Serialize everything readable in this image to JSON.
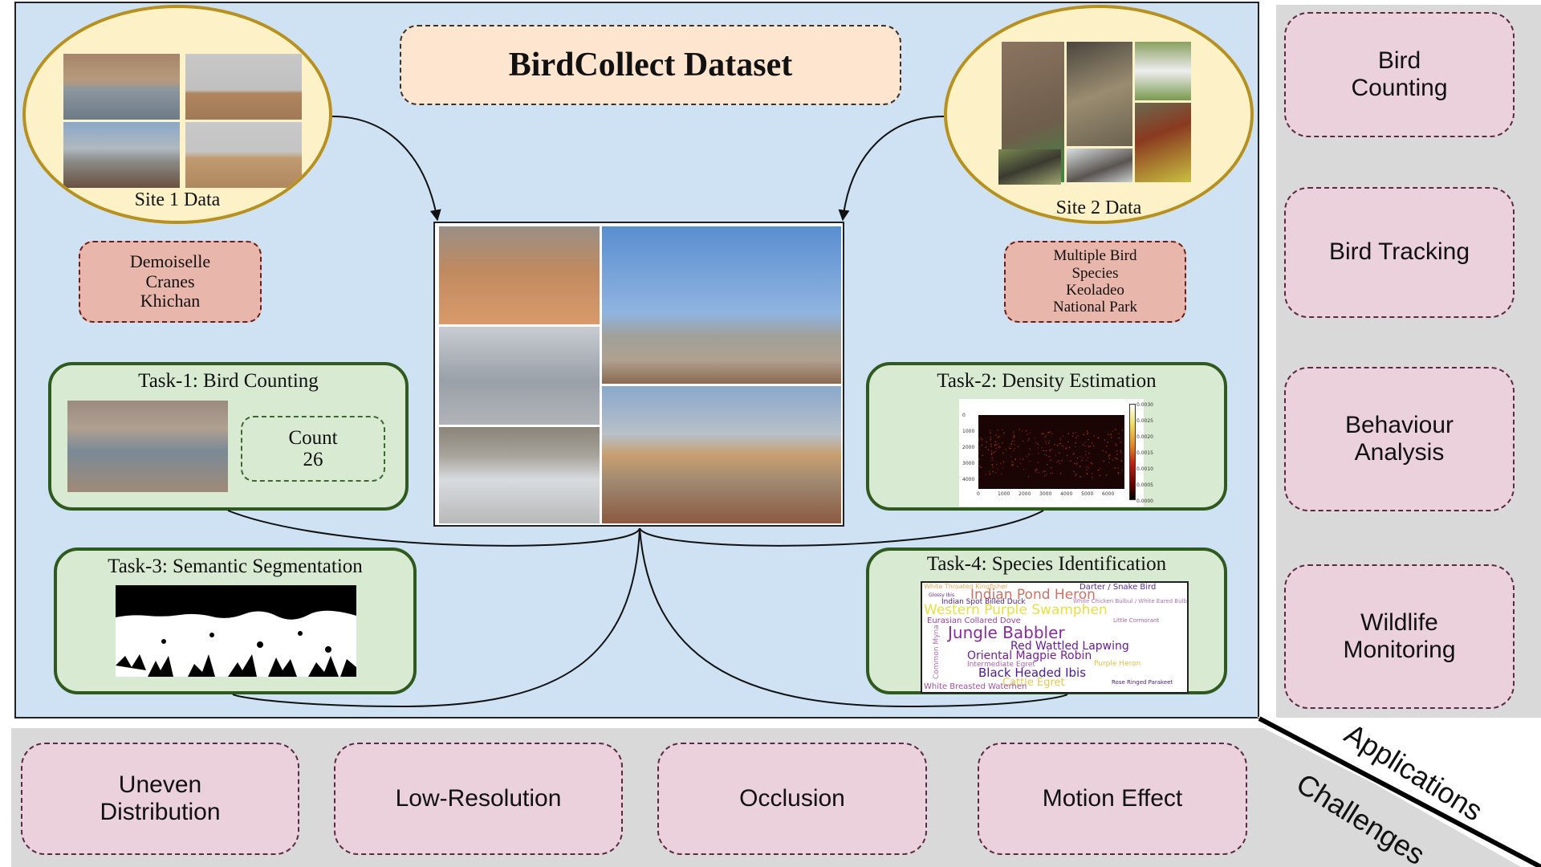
{
  "title": "BirdCollect Dataset",
  "sites": [
    {
      "label": "Site 1 Data",
      "source_lines": [
        "Demoiselle",
        "Cranes",
        "Khichan"
      ]
    },
    {
      "label": "Site 2 Data",
      "source_lines": [
        "Multiple Bird",
        "Species",
        "Keoladeo",
        "National Park"
      ]
    }
  ],
  "tasks": {
    "task1": {
      "title": "Task-1: Bird Counting",
      "count_label": "Count",
      "count_value": "26"
    },
    "task2": {
      "title": "Task-2: Density Estimation",
      "heatmap": {
        "y_ticks": [
          "0",
          "1000",
          "2000",
          "3000",
          "4000"
        ],
        "x_ticks": [
          "0",
          "1000",
          "2000",
          "3000",
          "4000",
          "5000",
          "6000"
        ],
        "colorbar_ticks": [
          "0.0030",
          "0.0025",
          "0.0020",
          "0.0015",
          "0.0010",
          "0.0005",
          "0.0000"
        ]
      }
    },
    "task3": {
      "title": "Task-3: Semantic Segmentation"
    },
    "task4": {
      "title": "Task-4: Species Identification",
      "wordcloud": [
        {
          "text": "White Throated Kingfisher",
          "color": "#e8a850"
        },
        {
          "text": "Darter / Snake Bird",
          "color": "#5a2a9a"
        },
        {
          "text": "Indian Pond Heron",
          "color": "#d07060"
        },
        {
          "text": "Glossy Ibis",
          "color": "#6a2a9a"
        },
        {
          "text": "Indian Spot Billed Duck",
          "color": "#4a1a8a"
        },
        {
          "text": "White Chicken Bulbul / White Eared Bulbul",
          "color": "#b070c0"
        },
        {
          "text": "Western Purple Swamphen",
          "color": "#e8e040"
        },
        {
          "text": "Eurasian Collared Dove",
          "color": "#9a40a0"
        },
        {
          "text": "Little Cormorant",
          "color": "#b060a0"
        },
        {
          "text": "Jungle Babbler",
          "color": "#8a2aa0"
        },
        {
          "text": "Red Wattled Lapwing",
          "color": "#6a1a9a"
        },
        {
          "text": "Common Myna",
          "color": "#b070b0"
        },
        {
          "text": "Oriental Magpie Robin",
          "color": "#7a1aa0"
        },
        {
          "text": "Intermediate Egret",
          "color": "#b060b0"
        },
        {
          "text": "Purple Heron",
          "color": "#e8c040"
        },
        {
          "text": "Black Headed Ibis",
          "color": "#4a1a9a"
        },
        {
          "text": "Cattle Egret",
          "color": "#e8c850"
        },
        {
          "text": "Rose Ringed Parakeet",
          "color": "#4a1a8a"
        },
        {
          "text": "White Breasted Waterhen",
          "color": "#a050a0"
        }
      ]
    }
  },
  "applications": {
    "label": "Applications",
    "items": [
      [
        "Bird",
        "Counting"
      ],
      [
        "Bird Tracking"
      ],
      [
        "Behaviour",
        "Analysis"
      ],
      [
        "Wildlife",
        "Monitoring"
      ]
    ]
  },
  "challenges": {
    "label": "Challenges",
    "items": [
      [
        "Uneven",
        "Distribution"
      ],
      [
        "Low-Resolution"
      ],
      [
        "Occlusion"
      ],
      [
        "Motion Effect"
      ]
    ]
  },
  "colors": {
    "main_panel": "#cfe2f3",
    "side_panels": "#d9d9d9",
    "title_box": "#fde5d0",
    "site_ellipse": "#fdf1c8",
    "site_border": "#b8901e",
    "source_box": "#e8b6ab",
    "task_box": "#d9ead3",
    "task_border": "#2f5a1e",
    "pink_box": "#ead1dc"
  }
}
